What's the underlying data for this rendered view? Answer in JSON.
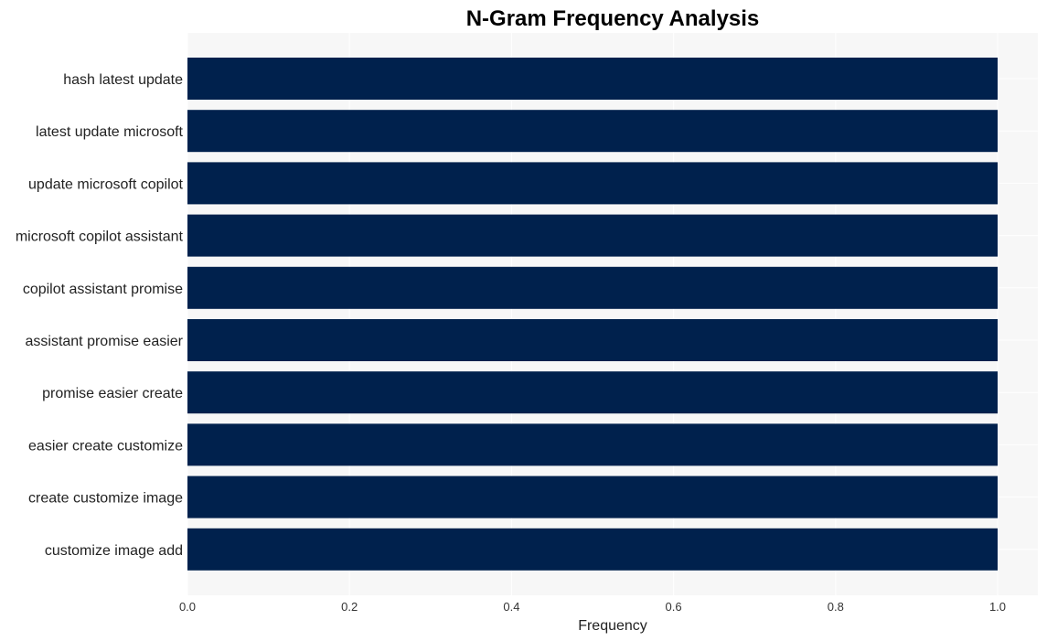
{
  "chart_data": {
    "type": "bar",
    "orientation": "horizontal",
    "title": "N-Gram Frequency Analysis",
    "xlabel": "Frequency",
    "ylabel": "",
    "categories": [
      "hash latest update",
      "latest update microsoft",
      "update microsoft copilot",
      "microsoft copilot assistant",
      "copilot assistant promise",
      "assistant promise easier",
      "promise easier create",
      "easier create customize",
      "create customize image",
      "customize image add"
    ],
    "values": [
      1,
      1,
      1,
      1,
      1,
      1,
      1,
      1,
      1,
      1
    ],
    "xlim": [
      0,
      1.05
    ],
    "xticks": [
      0.0,
      0.2,
      0.4,
      0.6,
      0.8,
      1.0
    ],
    "xtick_labels": [
      "0.0",
      "0.2",
      "0.4",
      "0.6",
      "0.8",
      "1.0"
    ],
    "grid": true,
    "legend": "none",
    "colors": {
      "bar": "#00214d",
      "plot_background": "#f7f7f7",
      "grid": "#ffffff"
    }
  }
}
